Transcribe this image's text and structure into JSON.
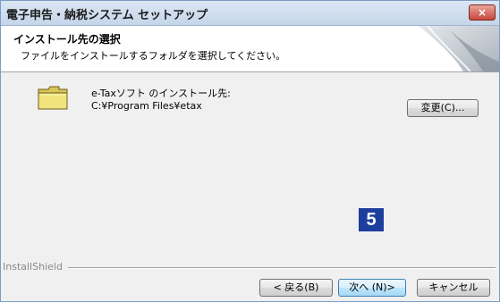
{
  "window": {
    "title": "電子申告・納税システム セットアップ",
    "close_label": "×"
  },
  "header": {
    "title": "インストール先の選択",
    "subtitle": "ファイルをインストールするフォルダを選択してください。"
  },
  "destination": {
    "label": "e-Taxソフト のインストール先:",
    "path": "C:¥Program Files¥etax",
    "change_button": "変更(C)..."
  },
  "annotation": {
    "step_badge": "5"
  },
  "footer": {
    "brand": "InstallShield",
    "back_button": "< 戻る(B)",
    "next_button": "次へ (N)>",
    "cancel_button": "キャンセル"
  },
  "icons": [
    "folder-icon",
    "close-icon",
    "installer-graphic"
  ],
  "colors": {
    "titlebar": "#c5d6ea",
    "close_button": "#c9463a",
    "badge": "#1d3e9d",
    "default_button": "#bee6fd"
  }
}
